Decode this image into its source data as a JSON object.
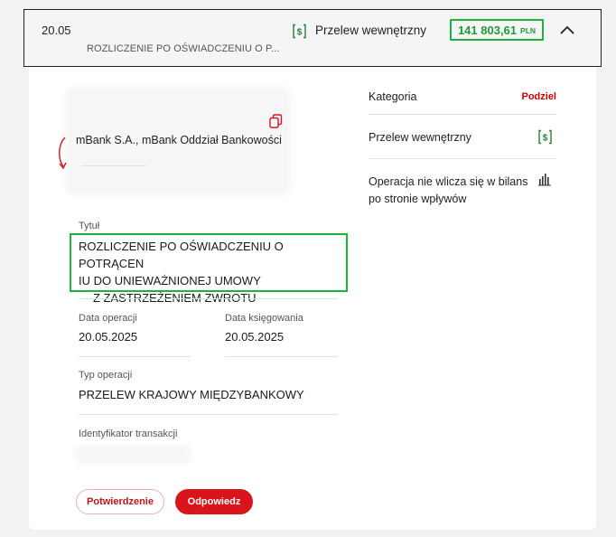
{
  "header": {
    "date": "20.05",
    "title": "ROZLICZENIE PO OŚWIADCZENIU O P...",
    "type_label": "Przelew wewnętrzny",
    "amount": "141 803,61",
    "currency": "PLN",
    "type_icon": "transfer-icon",
    "toggle_icon": "chevron-up-icon"
  },
  "counterparty": {
    "bank_name": "mBank S.A., mBank Oddział Bankowości"
  },
  "details": {
    "title_label": "Tytuł",
    "title_lines": [
      "ROZLICZENIE PO OŚWIADCZENIU O POTRĄCEN",
      "IU DO UNIEWAŻNIONEJ UMOWY",
      "Z ZASTRZEŻENIEM ZWROTU"
    ],
    "operation_date_label": "Data operacji",
    "operation_date": "20.05.2025",
    "booking_date_label": "Data księgowania",
    "booking_date": "20.05.2025",
    "operation_type_label": "Typ operacji",
    "operation_type": "PRZELEW KRAJOWY MIĘDZYBANKOWY",
    "transaction_id_label": "Identyfikator transakcji"
  },
  "sidebar": {
    "category_label": "Kategoria",
    "split_link": "Podziel",
    "category_value": "Przelew wewnętrzny",
    "balance_note": "Operacja nie wlicza się w bilans po stronie wpływów"
  },
  "actions": {
    "confirmation": "Potwierdzenie",
    "reply": "Odpowiedz"
  },
  "colors": {
    "accent_red": "#d9141c",
    "amount_green": "#1f9a39",
    "highlight_green": "#1fb33c"
  }
}
